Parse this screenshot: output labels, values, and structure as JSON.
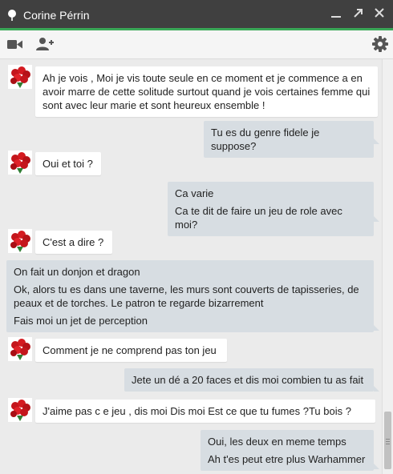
{
  "window": {
    "title": "Corine Pérrin",
    "accent_color": "#3aa757",
    "titlebar_color": "#404040",
    "controls": [
      "minimize-icon",
      "popout-icon",
      "close-icon"
    ]
  },
  "toolbar": {
    "left_icons": [
      "video-call-icon",
      "add-person-icon"
    ],
    "right_icons": [
      "gear-icon"
    ]
  },
  "messages": [
    {
      "from": "contact",
      "lines": [
        "Ah je vois  ,  Moi je vis toute seule en ce moment et je commence a en avoir marre de cette solitude surtout quand je vois certaines femme qui sont avec leur marie et sont heureux ensemble !"
      ]
    },
    {
      "from": "me",
      "lines": [
        "Tu es du genre fidele je suppose?"
      ]
    },
    {
      "from": "contact",
      "lines": [
        "Oui et toi ?"
      ]
    },
    {
      "from": "me",
      "lines": [
        "Ca varie",
        "Ca te dit de faire un jeu de role avec moi?"
      ]
    },
    {
      "from": "contact",
      "lines": [
        "C'est a dire ?"
      ]
    },
    {
      "from": "me",
      "lines": [
        "On fait un donjon et dragon",
        "Ok, alors tu es dans une taverne, les murs sont couverts de tapisseries, de peaux et de torches. Le patron te regarde bizarrement",
        "Fais moi un jet de perception"
      ]
    },
    {
      "from": "contact",
      "lines": [
        "Comment je ne comprend pas ton jeu"
      ]
    },
    {
      "from": "me",
      "lines": [
        "Jete un dé a 20 faces et dis moi combien tu as fait"
      ]
    },
    {
      "from": "contact",
      "lines": [
        " J'aime pas c e jeu , dis moi  Dis  moi  Est ce que tu fumes ?Tu bois ?"
      ]
    },
    {
      "from": "me",
      "lines": [
        "Oui, les deux en meme temps",
        "Ah t'es peut etre plus Warhammer"
      ]
    }
  ],
  "colors": {
    "incoming_bubble": "#ffffff",
    "outgoing_bubble": "#d7dde2",
    "chat_background": "#ebebeb"
  }
}
